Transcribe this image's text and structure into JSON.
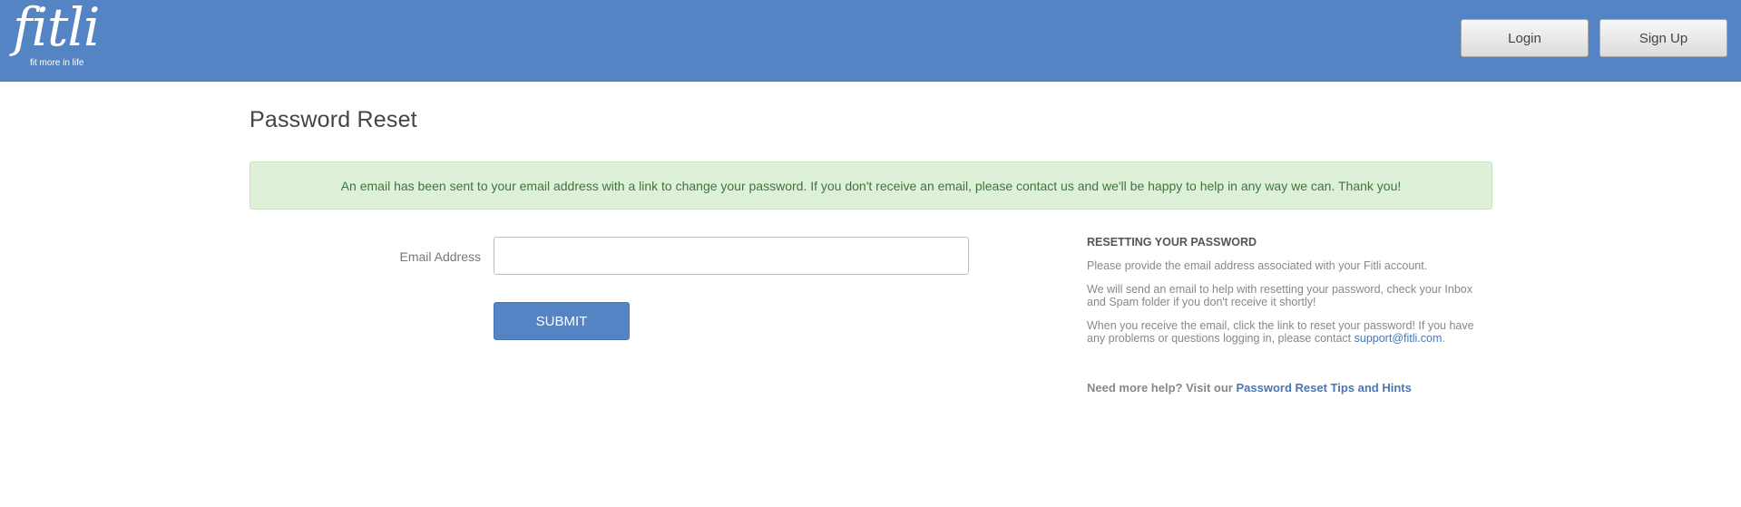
{
  "header": {
    "logo": {
      "word": "fitli",
      "tagline": "fit more in life"
    },
    "login_label": "Login",
    "signup_label": "Sign Up"
  },
  "page": {
    "title": "Password Reset",
    "alert": "An email has been sent to your email address with a link to change your password. If you don't receive an email, please contact us and we'll be happy to help in any way we can. Thank you!"
  },
  "form": {
    "email_label": "Email Address",
    "email_value": "",
    "email_placeholder": "",
    "submit_label": "SUBMIT"
  },
  "help": {
    "heading": "RESETTING YOUR PASSWORD",
    "p1": "Please provide the email address associated with your Fitli account.",
    "p2": "We will send an email to help with resetting your password, check your Inbox and Spam folder if you don't receive it shortly!",
    "p3_text": "When you receive the email, click the link to reset your password!  If you have any problems or questions logging in, please contact ",
    "p3_link": "support@fitli.com",
    "p3_end": ".",
    "more_text": "Need more help?  Visit our ",
    "more_link": "Password Reset Tips and Hints"
  },
  "colors": {
    "header_bg": "#5584c4",
    "alert_bg": "#dff0d8",
    "alert_text": "#3c763d",
    "link": "#4a76b2"
  }
}
